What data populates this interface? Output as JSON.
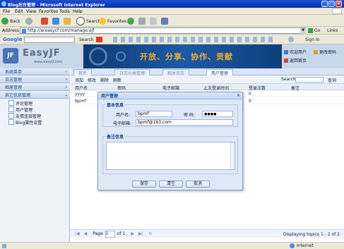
{
  "window": {
    "title": "Blog后台管理 - Microsoft Internet Explorer",
    "controls": [
      "_",
      "□",
      "×"
    ]
  },
  "menu": [
    "File",
    "Edit",
    "View",
    "Favorites",
    "Tools",
    "Help"
  ],
  "toolbar": {
    "back": "Back",
    "search": "Search",
    "favorites": "Favorites"
  },
  "address": {
    "label": "Address",
    "url": "http://w.easycf.com/manage.ejf",
    "go": "Go",
    "links": "Links"
  },
  "google_bar": {
    "logo": "Google",
    "search": "Search",
    "signin": "Sign In"
  },
  "header": {
    "logo": "EasyJF",
    "logo_sub": "www.easyjf.com",
    "slogan": "开放、分享、协作、贡献",
    "user_links": [
      "欢迎用户",
      "更改密码",
      "返回首页"
    ]
  },
  "sidebar": {
    "panels": [
      {
        "label": "系统菜单"
      },
      {
        "label": "日志管理"
      },
      {
        "label": "相册管理"
      },
      {
        "label": "其它信息管理"
      }
    ],
    "leaves": [
      "评论管理",
      "用户管理",
      "友情连接管理",
      "Blog属性设置"
    ]
  },
  "tabs": [
    "首页",
    "日志分类管理",
    "相关日志",
    "用户管理"
  ],
  "grid": {
    "toolbar": [
      "添加",
      "修改",
      "删除",
      "刷新"
    ],
    "search_label": "Search:",
    "search_button": "查询",
    "columns": [
      "用户名",
      "密码",
      "电子邮箱",
      "上次登录时间",
      "登录次数",
      "备注"
    ],
    "rows": [
      {
        "username": "yyyy",
        "password": "",
        "email": "",
        "last_login": "",
        "count": "0",
        "note": ""
      },
      {
        "username": "bpmf",
        "password": "",
        "email": "",
        "last_login": "",
        "count": "0",
        "note": ""
      }
    ]
  },
  "pager": {
    "page_label": "Page",
    "page_value": "1",
    "of_label": "of 1",
    "display": "Displaying topics 1 - 2 of 2"
  },
  "status": {
    "zone": "Internet"
  },
  "dialog": {
    "title": "用户管理",
    "basic_legend": "基本信息",
    "username_label": "用户名:",
    "username_value": "bpmf",
    "password_label": "密    码:",
    "password_value": "●●●●",
    "email_label": "电子邮箱:",
    "email_value": "bpmf@163.com",
    "note_legend": "备注信息",
    "buttons": [
      "保存",
      "清空",
      "取消"
    ]
  },
  "colors": {
    "title_bar": "#0a2fa8",
    "chrome": "#ece9d8",
    "panel": "#dfe8f6",
    "accent": "#15428b",
    "slogan": "#f2b030"
  }
}
